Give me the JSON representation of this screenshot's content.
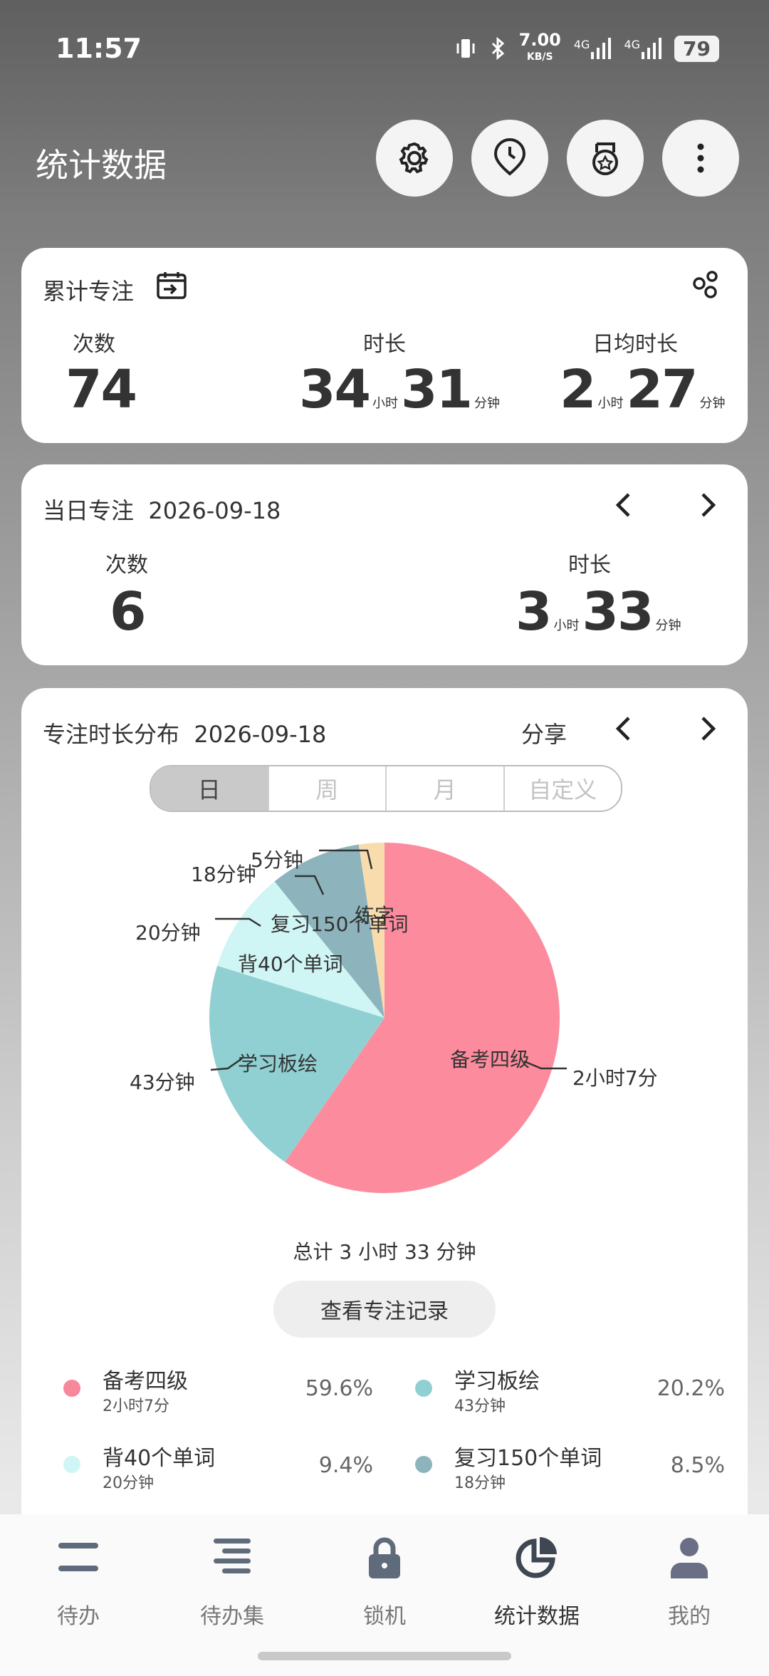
{
  "status_bar": {
    "time": "11:57",
    "speed_value": "7.00",
    "speed_unit": "KB/S",
    "net1": "4G",
    "net2": "4G",
    "battery": "79"
  },
  "header": {
    "title": "统计数据",
    "buttons": [
      "gear-icon",
      "clock-pin-icon",
      "medal-icon",
      "more-vert-icon"
    ]
  },
  "cumulative": {
    "title": "累计专注",
    "count_label": "次数",
    "count": "74",
    "duration_label": "时长",
    "duration_hours": "34",
    "duration_minutes": "31",
    "daily_label": "日均时长",
    "daily_hours": "2",
    "daily_minutes": "27",
    "unit_hour": "小时",
    "unit_minute": "分钟"
  },
  "daily": {
    "title": "当日专注",
    "date": "2026-09-18",
    "count_label": "次数",
    "count": "6",
    "duration_label": "时长",
    "duration_hours": "3",
    "duration_minutes": "33"
  },
  "distribution": {
    "title": "专注时长分布",
    "date": "2026-09-18",
    "share": "分享",
    "tabs": [
      "日",
      "周",
      "月",
      "自定义"
    ],
    "active_tab": "日",
    "total": "总计 3 小时 33 分钟",
    "view_records": "查看专注记录"
  },
  "chart_data": {
    "type": "pie",
    "total_minutes": 213,
    "slices": [
      {
        "name": "备考四级",
        "minutes": 127,
        "value_label": "2小时7分",
        "color": "#fc8c9d"
      },
      {
        "name": "学习板绘",
        "minutes": 43,
        "value_label": "43分钟",
        "color": "#91d0d2"
      },
      {
        "name": "背40个单词",
        "minutes": 20,
        "value_label": "20分钟",
        "color": "#d0f5f5"
      },
      {
        "name": "复习150个单词",
        "minutes": 18,
        "value_label": "18分钟",
        "color": "#8db4bc"
      },
      {
        "name": "练字",
        "minutes": 5,
        "value_label": "5分钟",
        "color": "#f9dcae"
      }
    ]
  },
  "legend": [
    {
      "name": "备考四级",
      "sub": "2小时7分",
      "pct": "59.6%",
      "color": "#f7879a"
    },
    {
      "name": "学习板绘",
      "sub": "43分钟",
      "pct": "20.2%",
      "color": "#91d0d2"
    },
    {
      "name": "背40个单词",
      "sub": "20分钟",
      "pct": "9.4%",
      "color": "#d0f5f5"
    },
    {
      "name": "复习150个单词",
      "sub": "18分钟",
      "pct": "8.5%",
      "color": "#8db4bc"
    }
  ],
  "bottom_nav": [
    {
      "label": "待办",
      "icon": "todo-icon"
    },
    {
      "label": "待办集",
      "icon": "todo-set-icon"
    },
    {
      "label": "锁机",
      "icon": "lock-icon"
    },
    {
      "label": "统计数据",
      "icon": "pie-chart-icon",
      "active": true
    },
    {
      "label": "我的",
      "icon": "profile-icon"
    }
  ]
}
